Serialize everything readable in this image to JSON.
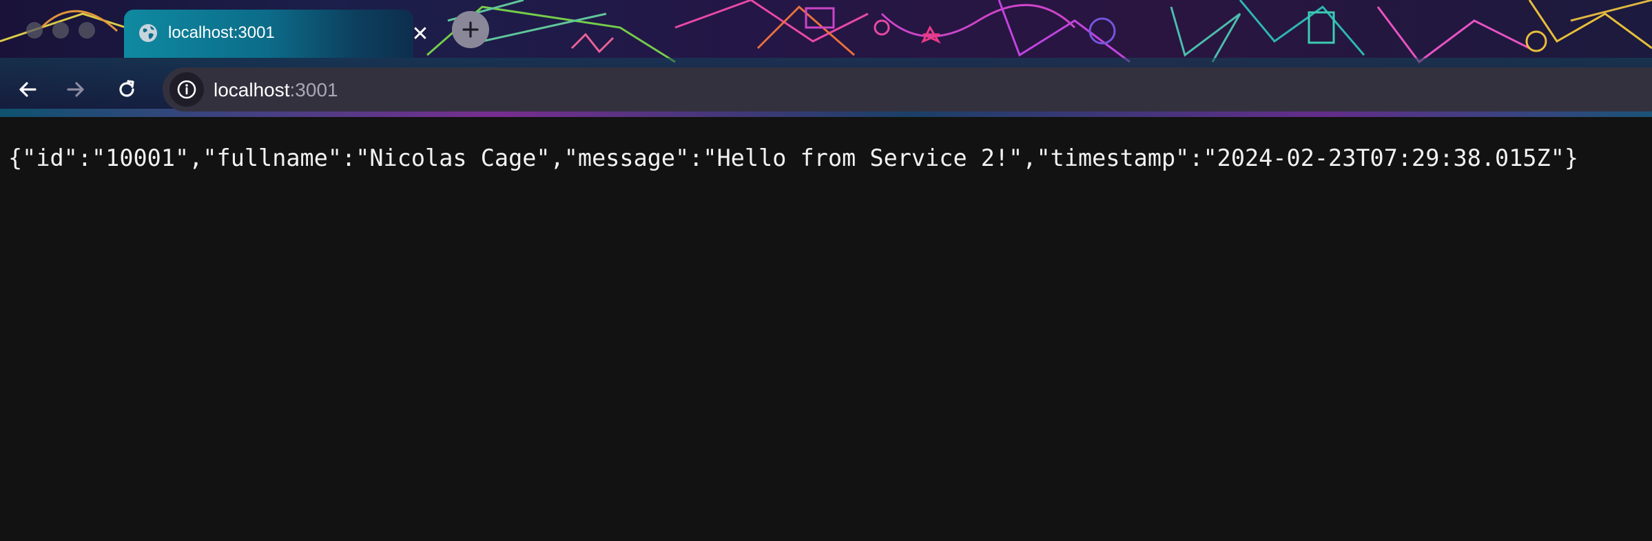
{
  "browser": {
    "tab": {
      "title": "localhost:3001",
      "close_glyph": "✕",
      "favicon": "globe-icon"
    },
    "new_tab_icon": "plus-icon",
    "nav": {
      "back_icon": "arrow-left-icon",
      "forward_icon": "arrow-right-icon",
      "reload_icon": "reload-icon"
    },
    "address_bar": {
      "host": "localhost",
      "port": ":3001",
      "site_info_icon": "info-icon"
    },
    "colors": {
      "page_background": "#121212",
      "omnibox_background": "#34313f",
      "tab_accent": "#0f8aa1"
    }
  },
  "page": {
    "json_text": "{\"id\":\"10001\",\"fullname\":\"Nicolas Cage\",\"message\":\"Hello from Service 2!\",\"timestamp\":\"2024-02-23T07:29:38.015Z\"}"
  }
}
